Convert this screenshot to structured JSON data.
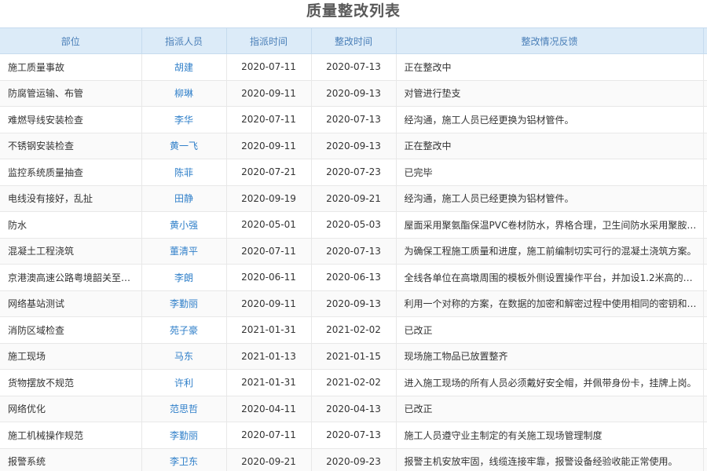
{
  "page_title": "质量整改列表",
  "columns": {
    "dept": "部位",
    "person": "指派人员",
    "assign_time": "指派时间",
    "fix_time": "整改时间",
    "feedback": "整改情况反馈"
  },
  "rows": [
    {
      "dept": "施工质量事故",
      "person": "胡建",
      "assign_time": "2020-07-11",
      "fix_time": "2020-07-13",
      "feedback": "正在整改中"
    },
    {
      "dept": "防腐管运输、布管",
      "person": "柳琳",
      "assign_time": "2020-09-11",
      "fix_time": "2020-09-13",
      "feedback": "对管进行垫支"
    },
    {
      "dept": "难燃导线安装检查",
      "person": "李华",
      "assign_time": "2020-07-11",
      "fix_time": "2020-07-13",
      "feedback": "经沟通，施工人员已经更换为铝材管件。"
    },
    {
      "dept": "不锈钢安装检查",
      "person": "黄一飞",
      "assign_time": "2020-09-11",
      "fix_time": "2020-09-13",
      "feedback": "正在整改中"
    },
    {
      "dept": "监控系统质量抽查",
      "person": "陈菲",
      "assign_time": "2020-07-21",
      "fix_time": "2020-07-23",
      "feedback": "已完毕"
    },
    {
      "dept": "电线没有接好，乱扯",
      "person": "田静",
      "assign_time": "2020-09-19",
      "fix_time": "2020-09-21",
      "feedback": "经沟通，施工人员已经更换为铝材管件。"
    },
    {
      "dept": "防水",
      "person": "黄小强",
      "assign_time": "2020-05-01",
      "fix_time": "2020-05-03",
      "feedback": "屋面采用聚氨酯保温PVC卷材防水，界格合理，卫生间防水采用聚胺…"
    },
    {
      "dept": "混凝土工程浇筑",
      "person": "董清平",
      "assign_time": "2020-07-11",
      "fix_time": "2020-07-13",
      "feedback": "为确保工程施工质量和进度，施工前编制切实可行的混凝土浇筑方案。"
    },
    {
      "dept": "京港澳高速公路粤境韶关至…",
      "person": "李朗",
      "assign_time": "2020-06-11",
      "fix_time": "2020-06-13",
      "feedback": "全线各单位在高墩周围的模板外侧设置操作平台，并加设1.2米高的护…"
    },
    {
      "dept": "网络基站测试",
      "person": "李勤丽",
      "assign_time": "2020-09-11",
      "fix_time": "2020-09-13",
      "feedback": "利用一个对称的方案，在数据的加密和解密过程中使用相同的密钥和…"
    },
    {
      "dept": "消防区域检查",
      "person": "苑子豪",
      "assign_time": "2021-01-31",
      "fix_time": "2021-02-02",
      "feedback": "已改正"
    },
    {
      "dept": "施工现场",
      "person": "马东",
      "assign_time": "2021-01-13",
      "fix_time": "2021-01-15",
      "feedback": "现场施工物品已放置整齐"
    },
    {
      "dept": "货物摆放不规范",
      "person": "许利",
      "assign_time": "2021-01-31",
      "fix_time": "2021-02-02",
      "feedback": "进入施工现场的所有人员必须戴好安全帽，并佩带身份卡，挂牌上岗。"
    },
    {
      "dept": "网络优化",
      "person": "范思哲",
      "assign_time": "2020-04-11",
      "fix_time": "2020-04-13",
      "feedback": "已改正"
    },
    {
      "dept": "施工机械操作规范",
      "person": "李勤丽",
      "assign_time": "2020-07-11",
      "fix_time": "2020-07-13",
      "feedback": "施工人员遵守业主制定的有关施工现场管理制度"
    },
    {
      "dept": "报警系统",
      "person": "李卫东",
      "assign_time": "2020-09-21",
      "fix_time": "2020-09-23",
      "feedback": "报警主机安放牢固，线缆连接牢靠，报警设备经验收能正常使用。"
    }
  ]
}
